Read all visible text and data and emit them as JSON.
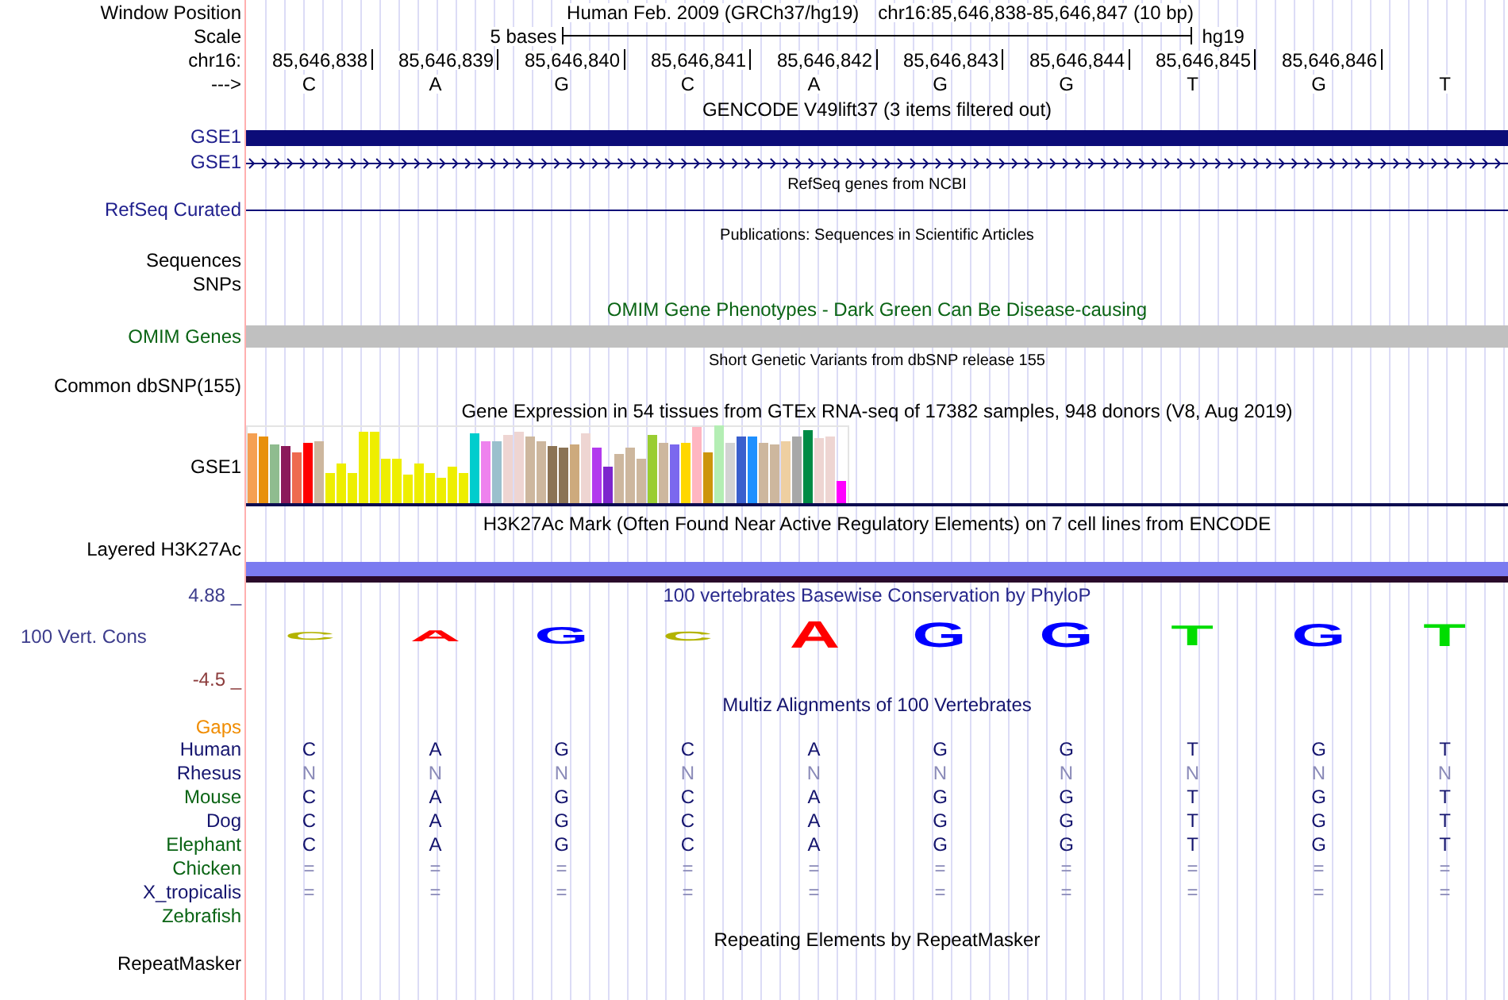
{
  "header": {
    "label": "Window Position",
    "assembly": "Human Feb. 2009 (GRCh37/hg19)",
    "position": "chr16:85,646,838-85,646,847 (10 bp)"
  },
  "scale": {
    "label": "Scale",
    "span": "5 bases",
    "assembly": "hg19"
  },
  "coordinates": {
    "label": "chr16:",
    "positions": [
      "85,646,838",
      "85,646,839",
      "85,646,840",
      "85,646,841",
      "85,646,842",
      "85,646,843",
      "85,646,844",
      "85,646,845",
      "85,646,846"
    ]
  },
  "sequence": {
    "label": "--->",
    "bases": [
      "C",
      "A",
      "G",
      "C",
      "A",
      "G",
      "G",
      "T",
      "G",
      "T"
    ]
  },
  "gencode": {
    "title": "GENCODE V49lift37 (3 items filtered out)",
    "genes": [
      {
        "label": "GSE1",
        "kind": "block"
      },
      {
        "label": "GSE1",
        "kind": "strand"
      }
    ]
  },
  "refseq": {
    "title": "RefSeq genes from NCBI",
    "label": "RefSeq Curated"
  },
  "publications": {
    "title": "Publications: Sequences in Scientific Articles",
    "labels": [
      "Sequences",
      "SNPs"
    ]
  },
  "omim": {
    "title": "OMIM Gene Phenotypes - Dark Green Can Be Disease-causing",
    "label": "OMIM Genes"
  },
  "dbsnp": {
    "title": "Short Genetic Variants from dbSNP release 155",
    "label": "Common dbSNP(155)"
  },
  "gtex": {
    "title": "Gene Expression in 54 tissues from GTEx RNA-seq of 17382 samples, 948 donors (V8, Aug 2019)",
    "label": "GSE1"
  },
  "h3k27ac": {
    "title": "H3K27Ac Mark (Often Found Near Active Regulatory Elements) on 7 cell lines from ENCODE",
    "label": "Layered H3K27Ac"
  },
  "phylop": {
    "title": "100 vertebrates Basewise Conservation by PhyloP",
    "label": "100 Vert. Cons",
    "max": "4.88 _",
    "min": "-4.5 _",
    "logo": [
      {
        "letter": "C",
        "color": "#b3b300"
      },
      {
        "letter": "A",
        "color": "#ff0000"
      },
      {
        "letter": "G",
        "color": "#0000ff"
      },
      {
        "letter": "C",
        "color": "#b3b300"
      },
      {
        "letter": "A",
        "color": "#ff0000"
      },
      {
        "letter": "G",
        "color": "#0000ff"
      },
      {
        "letter": "G",
        "color": "#0000ff"
      },
      {
        "letter": "T",
        "color": "#00dd00"
      },
      {
        "letter": "G",
        "color": "#0000ff"
      },
      {
        "letter": "T",
        "color": "#00dd00"
      }
    ]
  },
  "multiz": {
    "title": "Multiz Alignments of 100 Vertebrates",
    "gaps_label": "Gaps",
    "species": [
      {
        "name": "Human",
        "color": "#14146e",
        "faded": false,
        "bases": [
          "C",
          "A",
          "G",
          "C",
          "A",
          "G",
          "G",
          "T",
          "G",
          "T"
        ]
      },
      {
        "name": "Rhesus",
        "color": "#14146e",
        "faded": true,
        "bases": [
          "N",
          "N",
          "N",
          "N",
          "N",
          "N",
          "N",
          "N",
          "N",
          "N"
        ]
      },
      {
        "name": "Mouse",
        "color": "#0a6414",
        "faded": false,
        "bases": [
          "C",
          "A",
          "G",
          "C",
          "A",
          "G",
          "G",
          "T",
          "G",
          "T"
        ]
      },
      {
        "name": "Dog",
        "color": "#14146e",
        "faded": false,
        "bases": [
          "C",
          "A",
          "G",
          "C",
          "A",
          "G",
          "G",
          "T",
          "G",
          "T"
        ]
      },
      {
        "name": "Elephant",
        "color": "#0a6414",
        "faded": false,
        "bases": [
          "C",
          "A",
          "G",
          "C",
          "A",
          "G",
          "G",
          "T",
          "G",
          "T"
        ]
      },
      {
        "name": "Chicken",
        "color": "#0a6414",
        "faded": true,
        "bases": [
          "=",
          "=",
          "=",
          "=",
          "=",
          "=",
          "=",
          "=",
          "=",
          "="
        ]
      },
      {
        "name": "X_tropicalis",
        "color": "#14146e",
        "faded": true,
        "bases": [
          "=",
          "=",
          "=",
          "=",
          "=",
          "=",
          "=",
          "=",
          "=",
          "="
        ]
      },
      {
        "name": "Zebrafish",
        "color": "#0a6414"
      }
    ]
  },
  "repeatmasker": {
    "title": "Repeating Elements by RepeatMasker",
    "label": "RepeatMasker"
  }
}
